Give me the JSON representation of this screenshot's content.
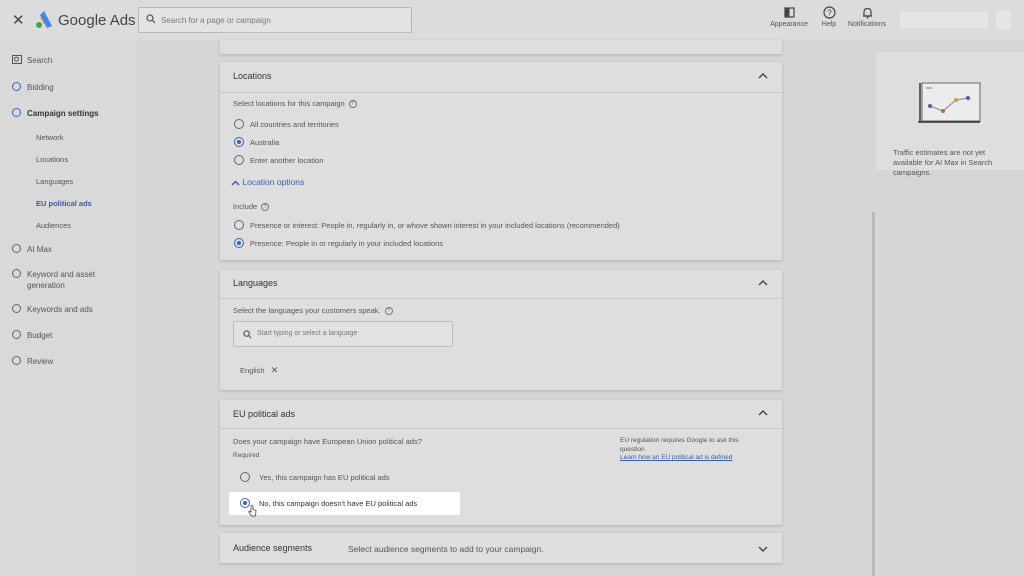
{
  "header": {
    "brand": "Google Ads",
    "search_placeholder": "Search for a page or campaign",
    "buttons": {
      "appearance": "Appearance",
      "help": "Help",
      "notifications": "Notifications"
    }
  },
  "sidebar": {
    "items": [
      {
        "label": "Search"
      },
      {
        "label": "Bidding"
      },
      {
        "label": "Campaign settings"
      },
      {
        "label": "AI Max"
      },
      {
        "label": "Keyword and asset generation"
      },
      {
        "label": "Keywords and ads"
      },
      {
        "label": "Budget"
      },
      {
        "label": "Review"
      }
    ],
    "subitems": [
      {
        "label": "Network"
      },
      {
        "label": "Locations"
      },
      {
        "label": "Languages"
      },
      {
        "label": "EU political ads"
      },
      {
        "label": "Audiences"
      }
    ]
  },
  "locations": {
    "title": "Locations",
    "prompt": "Select locations for this campaign",
    "options": [
      "All countries and territories",
      "Australia",
      "Enter another location"
    ],
    "selected": "Australia",
    "location_options_link": "Location options",
    "include_label": "Include",
    "include_options": [
      "Presence or interest: People in, regularly in, or whove shown interest in your included locations (recommended)",
      "Presence: People in or regularly in your included locations"
    ],
    "include_selected": "Presence: People in or regularly in your included locations"
  },
  "languages": {
    "title": "Languages",
    "prompt": "Select the languages your customers speak.",
    "search_placeholder": "Start typing or select a language",
    "chip": "English"
  },
  "eu_political": {
    "title": "EU political ads",
    "question": "Does your campaign have European Union political ads?",
    "required": "Required",
    "side_note": "EU regulation requires Google to ask this question",
    "side_link": "Learn how an EU political ad is defined",
    "options": [
      "Yes, this campaign has EU political ads",
      "No, this campaign doesn't have EU political ads"
    ],
    "selected": "No, this campaign doesn't have EU political ads"
  },
  "audience": {
    "title": "Audience segments",
    "subtitle": "Select audience segments to add to your campaign."
  },
  "right_panel": {
    "text": "Traffic estimates are not yet available for AI Max in Search campaigns."
  },
  "colors": {
    "accent": "#3a63b8",
    "link": "#3a5fa8"
  }
}
